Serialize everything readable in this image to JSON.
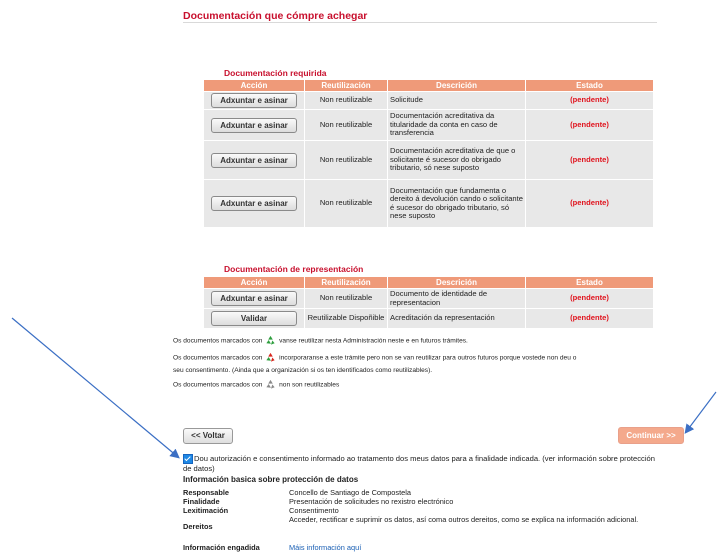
{
  "section_title": "Documentación que cómpre achegar",
  "required": {
    "title": "Documentación requirida",
    "headers": [
      "Acción",
      "Reutilización",
      "Descrición",
      "Estado"
    ],
    "rows": [
      {
        "action": "Adxuntar e asinar",
        "reuse": "Non reutilizable",
        "desc": "Solicitude",
        "status": "(pendente)"
      },
      {
        "action": "Adxuntar e asinar",
        "reuse": "Non reutilizable",
        "desc": "Documentación acreditativa da titularidade da conta en caso de transferencia",
        "status": "(pendente)"
      },
      {
        "action": "Adxuntar e asinar",
        "reuse": "Non reutilizable",
        "desc": "Documentación acreditativa de que o solicitante é sucesor do obrigado tributario, só nese suposto",
        "status": "(pendente)"
      },
      {
        "action": "Adxuntar e asinar",
        "reuse": "Non reutilizable",
        "desc": "Documentación que fundamenta o dereito á devolución cando o solicitante é sucesor do obrigado tributario, só nese suposto",
        "status": "(pendente)"
      }
    ]
  },
  "representation": {
    "title": "Documentación de representación",
    "headers": [
      "Acción",
      "Reutilización",
      "Descrición",
      "Estado"
    ],
    "rows": [
      {
        "action": "Adxuntar e asinar",
        "reuse": "Non reutilizable",
        "desc": "Documento de identidade de representacion",
        "status": "(pendente)"
      },
      {
        "action": "Validar",
        "reuse": "Reutilizable Dispoñible",
        "desc": "Acreditación da representación",
        "status": "(pendente)"
      }
    ]
  },
  "notes": {
    "prefix": "Os documentos marcados con",
    "n1": "vanse reutilizar nesta Administración neste e en futuros trámites.",
    "n2a": "incorporaranse a este trámite pero non se van reutilizar para outros futuros porque vostede non deu o",
    "n2b": "seu consentimento. (Ainda que a organización si os ten identificados como reutilizables).",
    "n3": "non son reutilizables",
    "colors": {
      "green": "#2e9e3e",
      "red": "#d7261e",
      "grey": "#8a8a8a"
    }
  },
  "nav": {
    "back": "<< Voltar",
    "next": "Continuar >>"
  },
  "consent": {
    "text": "Dou autorización e consentimento informado ao tratamento dos meus datos para a finalidade indicada. (ver información sobre protección de datos)",
    "checked": true
  },
  "basic_info": {
    "title": "Información basica sobre protección de datos",
    "rows": [
      {
        "k": "Responsable",
        "v": "Concello de Santiago de Compostela"
      },
      {
        "k": "Finalidade",
        "v": "Presentación de solicitudes no rexistro electrónico"
      },
      {
        "k": "Lexitimación",
        "v": "Consentimento"
      },
      {
        "k": "Dereitos",
        "v": "Acceder, rectificar e suprimir os datos, así coma outros dereitos, como se explica na información adicional."
      },
      {
        "k": "Información engadida",
        "v": "Máis información aquí"
      }
    ]
  },
  "accent": "#c8102e",
  "header_color": "#ef9a79"
}
